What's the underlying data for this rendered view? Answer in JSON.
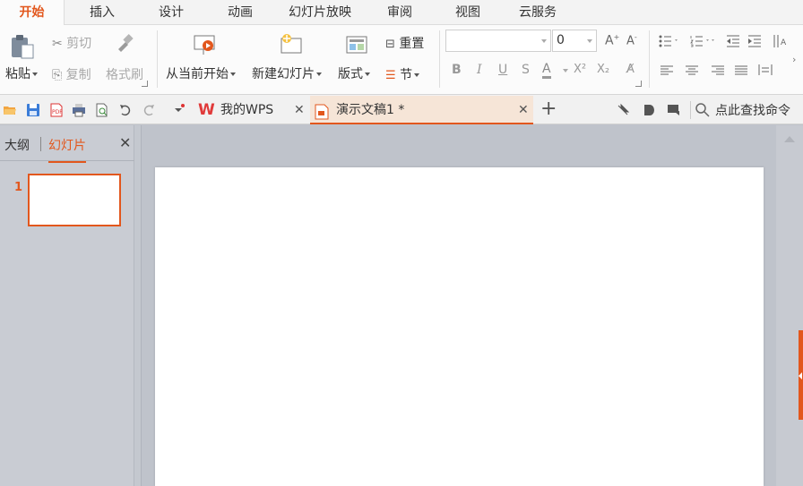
{
  "menu": {
    "tabs": [
      {
        "label": "开始",
        "active": true
      },
      {
        "label": "插入"
      },
      {
        "label": "设计"
      },
      {
        "label": "动画"
      },
      {
        "label": "幻灯片放映"
      },
      {
        "label": "审阅"
      },
      {
        "label": "视图"
      },
      {
        "label": "云服务"
      }
    ]
  },
  "ribbon": {
    "paste_label": "粘贴",
    "cut_label": "剪切",
    "copy_label": "复制",
    "format_painter_label": "格式刷",
    "from_current_label": "从当前开始",
    "new_slide_label": "新建幻灯片",
    "layout_label": "版式",
    "reset_label": "重置",
    "section_label": "节",
    "font_name_value": "",
    "font_size_value": "0",
    "bold": "B",
    "italic": "I",
    "underline": "U",
    "strike": "S",
    "font_color": "A",
    "superscript": "X²",
    "subscript": "X₂"
  },
  "tabbar": {
    "my_wps_label": "我的WPS",
    "doc_tab_label": "演示文稿1 *",
    "add_tab": "+",
    "search_label": "点此查找命令"
  },
  "leftpanel": {
    "tab_outline": "大纲",
    "tab_slides": "幻灯片",
    "slide_number": "1"
  },
  "colors": {
    "accent": "#e2571d",
    "ribbon_bg": "#fbfbfb",
    "workspace_bg": "#bfc3cb"
  }
}
